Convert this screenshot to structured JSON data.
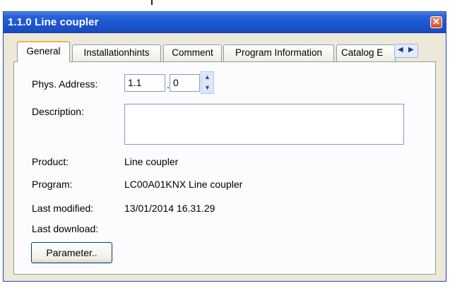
{
  "window": {
    "title": "1.1.0 Line coupler",
    "close_glyph": "✕"
  },
  "tabs": [
    {
      "label": "General",
      "active": true
    },
    {
      "label": "Installationhints",
      "active": false
    },
    {
      "label": "Comment",
      "active": false
    },
    {
      "label": "Program Information",
      "active": false
    },
    {
      "label": "Catalog E",
      "active": false
    }
  ],
  "tab_scroll": {
    "left": "◀",
    "right": "▶"
  },
  "form": {
    "phys_address_label": "Phys. Address:",
    "phys_address_part1": "1.1",
    "phys_address_separator": ".",
    "phys_address_part2": "0",
    "description_label": "Description:",
    "description_value": "",
    "product_label": "Product:",
    "product_value": "Line coupler",
    "program_label": "Program:",
    "program_value": "LC00A01KNX Line coupler",
    "last_modified_label": "Last modified:",
    "last_modified_value": "13/01/2014 16.31.29",
    "last_download_label": "Last download:",
    "last_download_value": "",
    "parameter_button": "Parameter.."
  },
  "icons": {
    "close": "close-icon",
    "spin_up": "chevron-up-icon",
    "spin_down": "chevron-down-icon",
    "tab_left": "chevron-left-icon",
    "tab_right": "chevron-right-icon"
  },
  "colors": {
    "titlebar": "#1d56d2",
    "dialog_bg": "#ece9d8",
    "active_tab_accent": "#f5b443",
    "close_button": "#d44d26"
  }
}
